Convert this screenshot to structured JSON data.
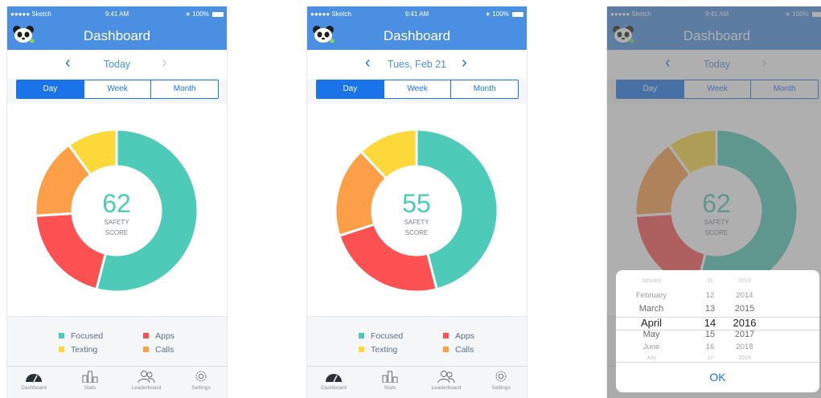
{
  "status": {
    "carrier": "●●●●● Sketch",
    "time": "9:41 AM",
    "battery": "100%"
  },
  "nav": {
    "title": "Dashboard"
  },
  "colors": {
    "focused": "#4ecbb8",
    "apps": "#fc5152",
    "texting": "#fdd83a",
    "calls": "#fd9e48",
    "accent": "#1a73e8",
    "header": "#4a8fe2"
  },
  "screens": [
    {
      "date": "Today",
      "score": "62",
      "segments": {
        "focused": 0.54,
        "apps": 0.2,
        "calls": 0.16,
        "texting": 0.1
      }
    },
    {
      "date": "Tues, Feb 21",
      "score": "55",
      "segments": {
        "focused": 0.46,
        "apps": 0.24,
        "calls": 0.18,
        "texting": 0.12
      }
    },
    {
      "date": "Today",
      "score": "62",
      "segments": {
        "focused": 0.54,
        "apps": 0.2,
        "calls": 0.16,
        "texting": 0.1
      }
    }
  ],
  "segmented": {
    "day": "Day",
    "week": "Week",
    "month": "Month"
  },
  "score_label_1": "SAFETY",
  "score_label_2": "SCORE",
  "legend": {
    "focused": "Focused",
    "apps": "Apps",
    "texting": "Texting",
    "calls": "Calls"
  },
  "tabs": {
    "dashboard": "Dashboard",
    "stats": "Stats",
    "leaderboard": "Leaderboard",
    "settings": "Settings"
  },
  "picker": {
    "months": [
      "January",
      "February",
      "March",
      "April",
      "May",
      "June",
      "July"
    ],
    "days": [
      "11",
      "12",
      "13",
      "14",
      "15",
      "16",
      "17"
    ],
    "years": [
      "2013",
      "2014",
      "2015",
      "2016",
      "2017",
      "2018",
      "2019"
    ],
    "selected_index": 3,
    "ok": "OK"
  }
}
